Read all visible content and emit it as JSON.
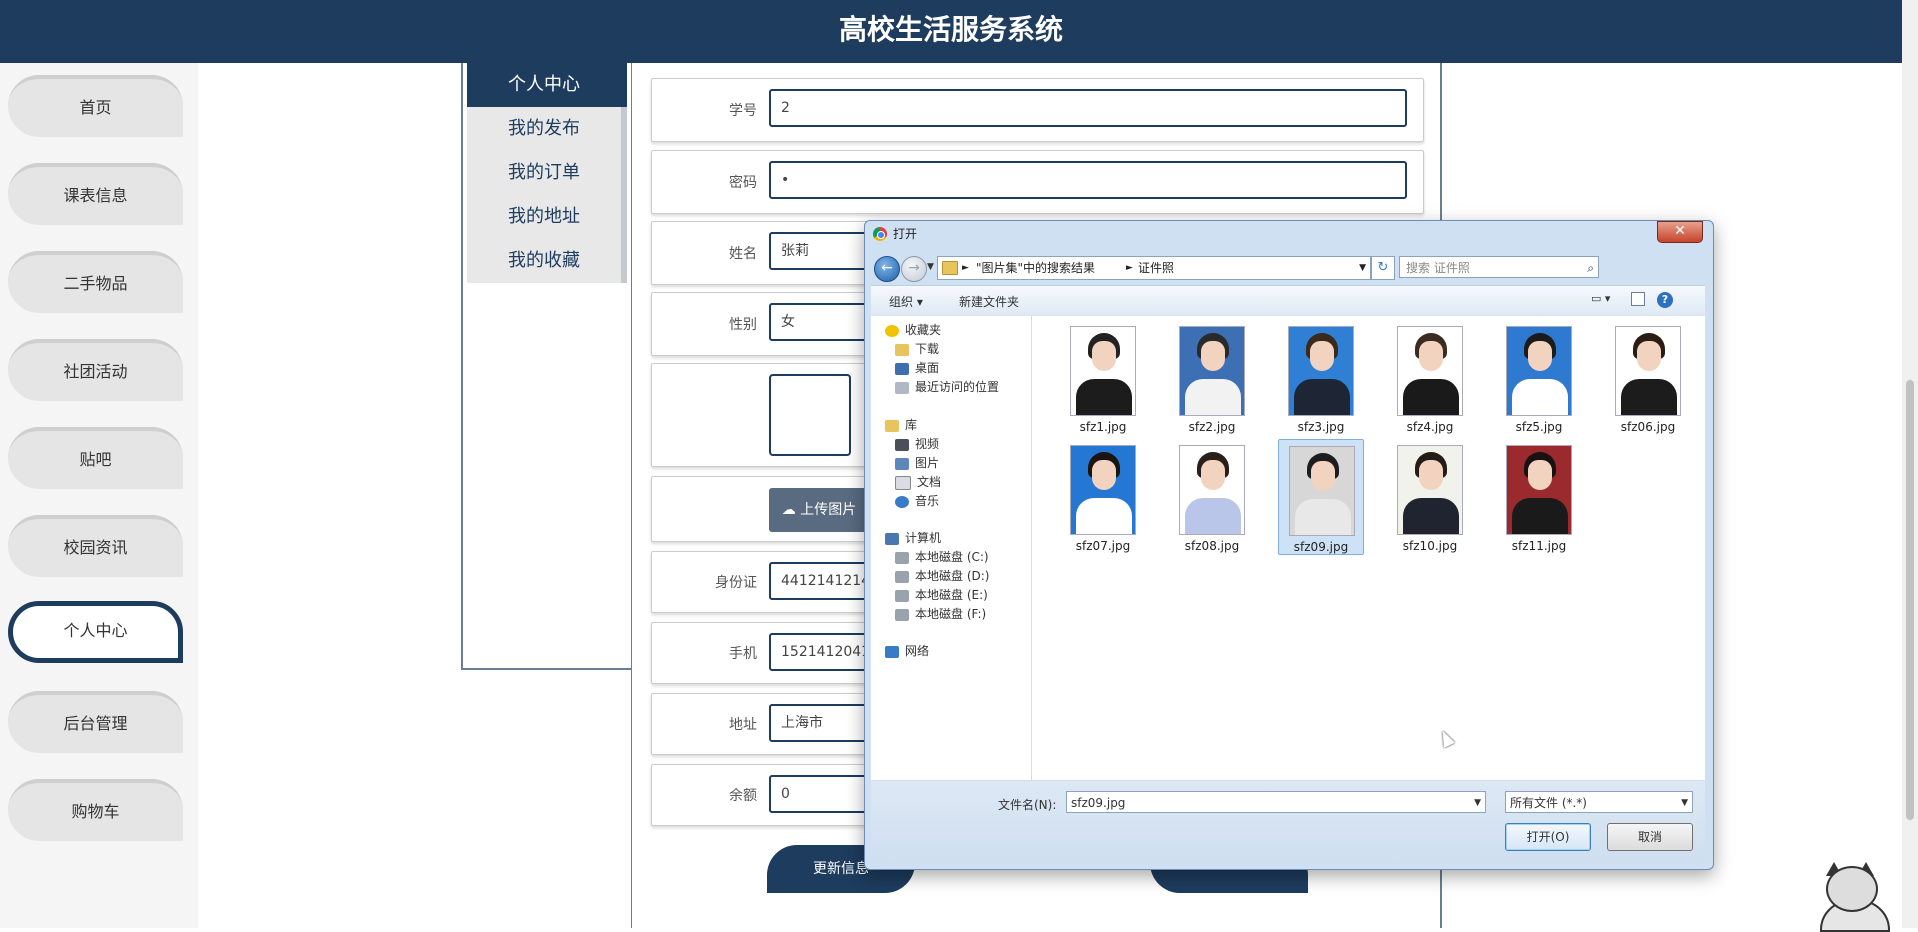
{
  "header": {
    "title": "高校生活服务系统"
  },
  "leftnav": [
    {
      "label": "首页"
    },
    {
      "label": "课表信息"
    },
    {
      "label": "二手物品"
    },
    {
      "label": "社团活动"
    },
    {
      "label": "贴吧"
    },
    {
      "label": "校园资讯"
    },
    {
      "label": "个人中心",
      "active": true
    },
    {
      "label": "后台管理"
    },
    {
      "label": "购物车"
    }
  ],
  "submenu": [
    {
      "label": "个人中心",
      "active": true
    },
    {
      "label": "我的发布"
    },
    {
      "label": "我的订单"
    },
    {
      "label": "我的地址"
    },
    {
      "label": "我的收藏"
    }
  ],
  "form": {
    "student_id": {
      "label": "学号",
      "value": "2"
    },
    "password": {
      "label": "密码",
      "value": "•"
    },
    "name": {
      "label": "姓名",
      "value": "张莉"
    },
    "gender": {
      "label": "性别",
      "value": "女"
    },
    "upload_label": "上传图片",
    "id_card": {
      "label": "身份证",
      "value": "44121412141"
    },
    "phone": {
      "label": "手机",
      "value": "15214120411"
    },
    "address": {
      "label": "地址",
      "value": "上海市"
    },
    "balance": {
      "label": "余额",
      "value": "0"
    },
    "update_label": "更新信息"
  },
  "dialog": {
    "title": "打开",
    "close_glyph": "✕",
    "path": {
      "segment1": "\"图片集\"中的搜索结果",
      "segment2": "证件照"
    },
    "search_placeholder": "搜索 证件照",
    "toolbar": {
      "organize": "组织 ▾",
      "new_folder": "新建文件夹",
      "help": "?"
    },
    "nav": {
      "favorites": "收藏夹",
      "downloads": "下载",
      "desktop": "桌面",
      "recent": "最近访问的位置",
      "libraries": "库",
      "videos": "视频",
      "pictures": "图片",
      "documents": "文档",
      "music": "音乐",
      "computer": "计算机",
      "disk_c": "本地磁盘 (C:)",
      "disk_d": "本地磁盘 (D:)",
      "disk_e": "本地磁盘 (E:)",
      "disk_f": "本地磁盘 (F:)",
      "network": "网络"
    },
    "files": [
      {
        "name": "sfz1.jpg",
        "bg": "#ffffff",
        "hair": "#222222",
        "body": "#1c1c1c"
      },
      {
        "name": "sfz2.jpg",
        "bg": "#3d6fb5",
        "hair": "#2a2a2a",
        "body": "#f2f2f2"
      },
      {
        "name": "sfz3.jpg",
        "bg": "#2f7fd4",
        "hair": "#3a2a1c",
        "body": "#1e2535"
      },
      {
        "name": "sfz4.jpg",
        "bg": "#ffffff",
        "hair": "#3a2c20",
        "body": "#1a1a1a"
      },
      {
        "name": "sfz5.jpg",
        "bg": "#2e7ad1",
        "hair": "#1b1b1b",
        "body": "#ffffff"
      },
      {
        "name": "sfz06.jpg",
        "bg": "#ffffff",
        "hair": "#2b1d14",
        "body": "#1c1c1c"
      },
      {
        "name": "sfz07.jpg",
        "bg": "#2477d3",
        "hair": "#1c1410",
        "body": "#ffffff"
      },
      {
        "name": "sfz08.jpg",
        "bg": "#ffffff",
        "hair": "#2a1e18",
        "body": "#b9c6ea"
      },
      {
        "name": "sfz09.jpg",
        "bg": "#d7d7d7",
        "hair": "#1d1d1d",
        "body": "#e8e8e8",
        "selected": true
      },
      {
        "name": "sfz10.jpg",
        "bg": "#f2f2ec",
        "hair": "#241c16",
        "body": "#1f2430"
      },
      {
        "name": "sfz11.jpg",
        "bg": "#9b2a2e",
        "hair": "#1a1212",
        "body": "#1a1a1a"
      }
    ],
    "filename_label": "文件名(N):",
    "filename_value": "sfz09.jpg",
    "filetype_value": "所有文件 (*.*)",
    "open_label": "打开(O)",
    "cancel_label": "取消"
  }
}
